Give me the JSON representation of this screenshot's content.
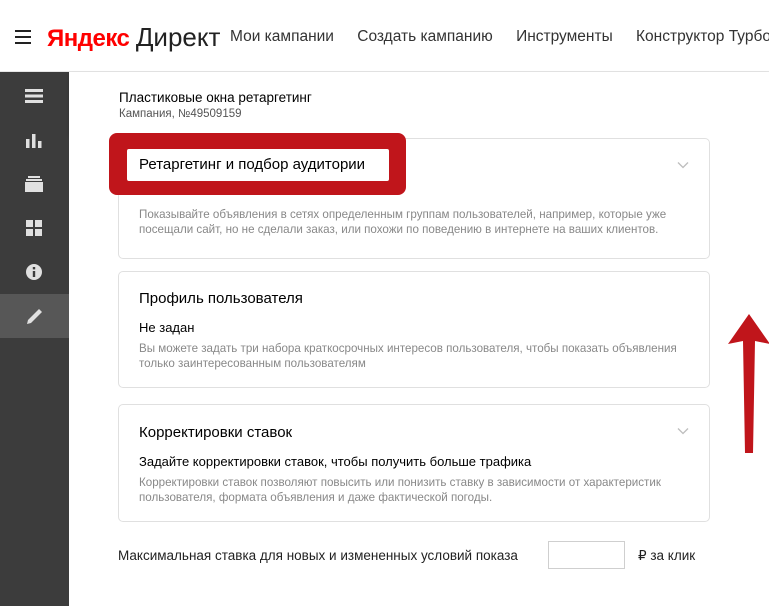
{
  "header": {
    "logo_brand": "Яндекс",
    "logo_product": "Директ",
    "nav": [
      "Мои кампании",
      "Создать кампанию",
      "Инструменты",
      "Конструктор Турбо-"
    ]
  },
  "sidebar": {
    "items": [
      {
        "icon": "list-icon",
        "active": false
      },
      {
        "icon": "bar-chart-icon",
        "active": false
      },
      {
        "icon": "stack-icon",
        "active": false
      },
      {
        "icon": "grid-icon",
        "active": false
      },
      {
        "icon": "info-icon",
        "active": false
      },
      {
        "icon": "pencil-icon",
        "active": true
      }
    ]
  },
  "campaign": {
    "name": "Пластиковые окна ретаргетинг",
    "id_label": "Кампания, №49509159"
  },
  "cards": {
    "retargeting": {
      "title": "Ретаргетинг и подбор аудитории",
      "description": "Показывайте объявления в сетях определенным группам пользователей, например, которые уже посещали сайт, но не сделали заказ, или похожи по поведению в интернете на ваших клиентов."
    },
    "profile": {
      "title": "Профиль пользователя",
      "status": "Не задан",
      "description": "Вы можете задать три набора краткосрочных интересов пользователя, чтобы показать объявления только заинтересованным пользователям"
    },
    "bid_adjustments": {
      "title": "Корректировки ставок",
      "subtitle": "Задайте корректировки ставок, чтобы получить больше трафика",
      "description": "Корректировки ставок позволяют повысить или понизить ставку в зависимости от характеристик пользователя, формата объявления и даже фактической погоды."
    }
  },
  "max_bid": {
    "label": "Максимальная ставка для новых и измененных условий показа",
    "value": "",
    "unit": "₽ за клик"
  },
  "colors": {
    "brand_red": "#ff0000",
    "annotation_red": "#c0151b",
    "sidebar_bg": "#3c3c3c"
  }
}
